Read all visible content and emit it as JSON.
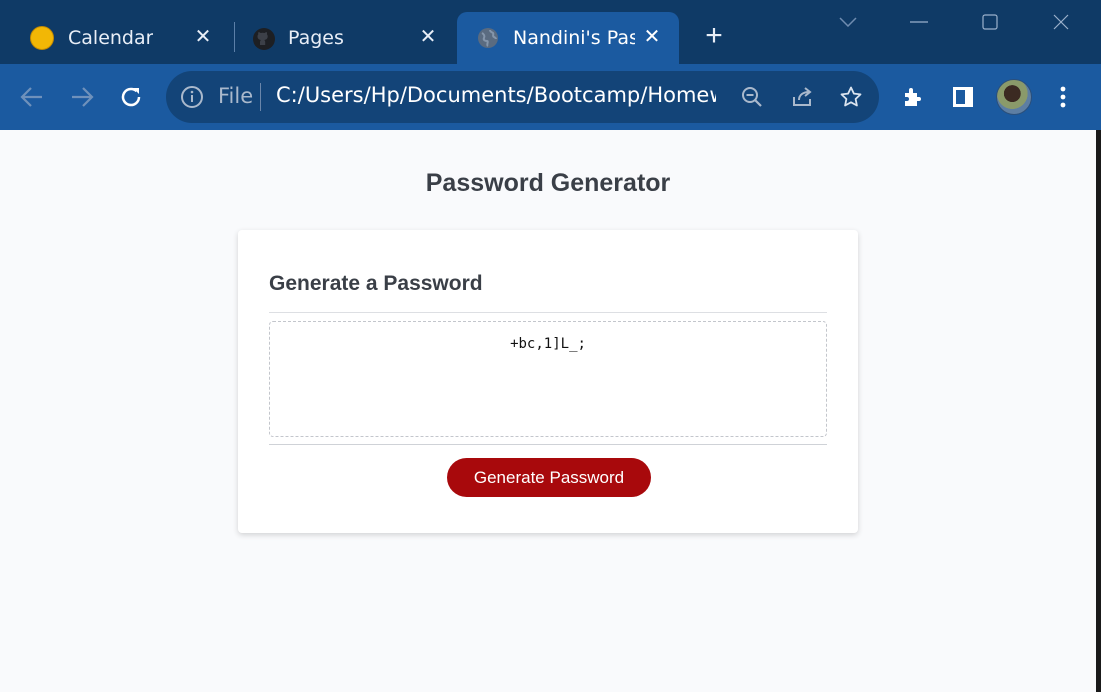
{
  "browser": {
    "tabs": [
      {
        "label": "Calendar",
        "favicon": "calendar-favicon",
        "active": false
      },
      {
        "label": "Pages",
        "favicon": "github-icon",
        "active": false
      },
      {
        "label": "Nandini's Passw",
        "favicon": "globe-icon",
        "active": true
      }
    ],
    "new_tab_icon": "plus-icon",
    "window_controls": [
      "chevron-down-icon",
      "minimize-icon",
      "maximize-icon",
      "close-icon"
    ],
    "toolbar": {
      "file_label": "File",
      "url": "C:/Users/Hp/Documents/Bootcamp/Homew...",
      "icons": [
        "back-arrow-icon",
        "forward-arrow-icon",
        "reload-icon",
        "info-icon",
        "zoom-out-icon",
        "share-icon",
        "star-icon",
        "extensions-icon",
        "side-panel-icon",
        "avatar",
        "menu-kebab-icon"
      ]
    }
  },
  "page": {
    "title": "Password Generator",
    "card": {
      "header": "Generate a Password",
      "password_value": "+bc,1]L_;",
      "button_label": "Generate Password"
    }
  },
  "colors": {
    "tabstrip": "#0f3a66",
    "toolbar": "#1b5aa0",
    "omnibox": "#134478",
    "button": "#a8090c",
    "page_bg": "#f9fafc"
  }
}
